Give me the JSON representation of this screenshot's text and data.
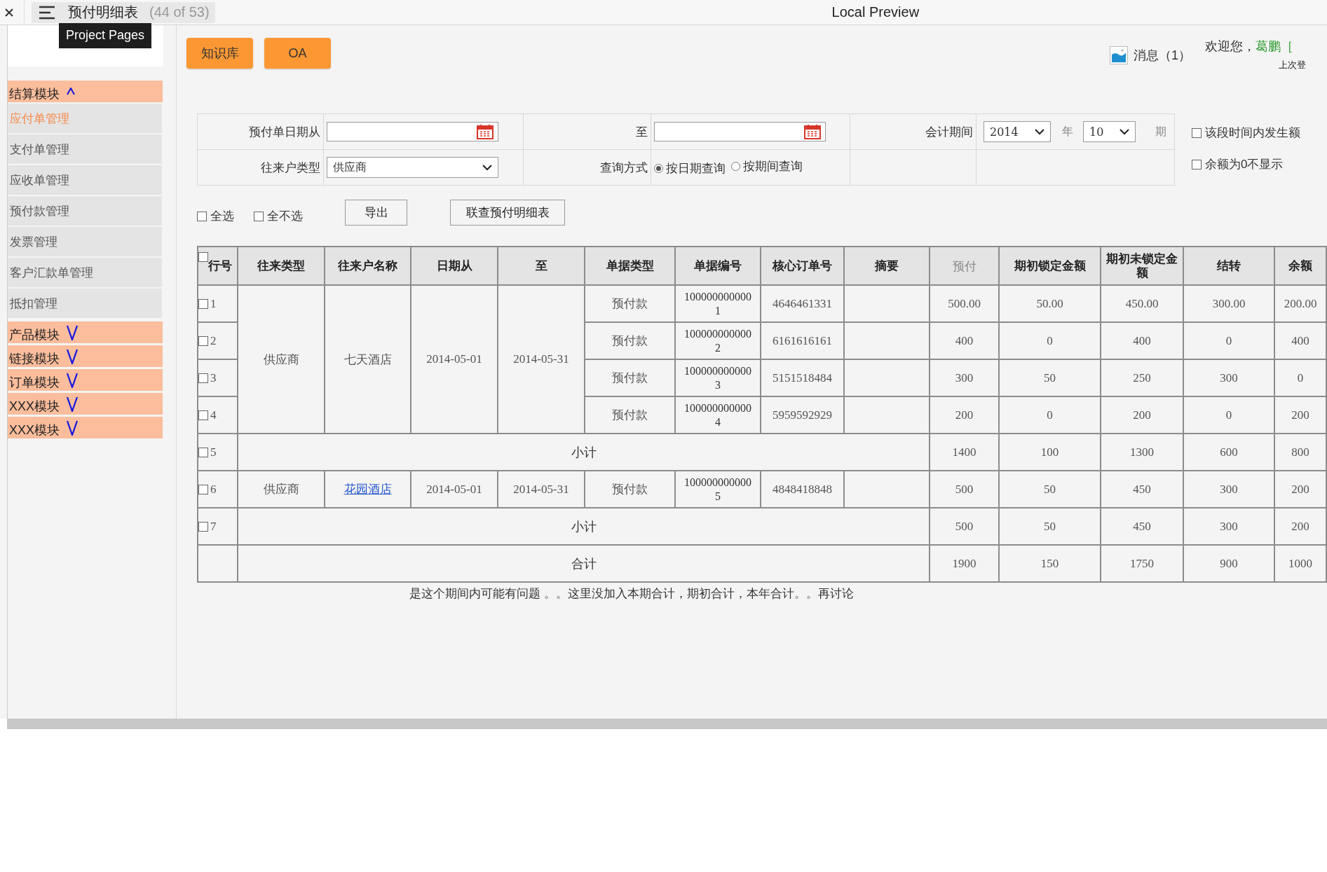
{
  "topbar": {
    "title": "预付明细表",
    "counter": "(44 of 53)",
    "app_title": "Local Preview"
  },
  "tooltip": "Project Pages",
  "sidebar": {
    "modules": [
      {
        "label": "结算模块",
        "expanded": true,
        "children": [
          {
            "label": "应付单管理",
            "selected": true
          },
          {
            "label": "支付单管理",
            "selected": false
          },
          {
            "label": "应收单管理",
            "selected": false
          },
          {
            "label": "预付款管理",
            "selected": false
          },
          {
            "label": "发票管理",
            "selected": false
          },
          {
            "label": "客户汇款单管理",
            "selected": false
          },
          {
            "label": "抵扣管理",
            "selected": false
          }
        ]
      },
      {
        "label": "产品模块",
        "expanded": false
      },
      {
        "label": "链接模块",
        "expanded": false
      },
      {
        "label": "订单模块",
        "expanded": false
      },
      {
        "label": "XXX模块",
        "expanded": false
      },
      {
        "label": "XXX模块",
        "expanded": false
      }
    ]
  },
  "header": {
    "buttons": [
      "知识库",
      "OA"
    ],
    "messages": "消息（1）",
    "welcome": "欢迎您，",
    "user": "葛鹏",
    "user_suffix": "［",
    "last_login": "上次登"
  },
  "filters": {
    "date_from_label": "预付单日期从",
    "date_to_label": "至",
    "period_label": "会计期间",
    "year": "2014",
    "year_unit": "年",
    "month": "10",
    "month_unit": "期",
    "partner_type_label": "往来户类型",
    "partner_type": "供应商",
    "query_mode_label": "查询方式",
    "query_modes": [
      {
        "label": "按日期查询",
        "selected": true
      },
      {
        "label": "按期间查询",
        "selected": false
      }
    ],
    "options": [
      {
        "label": "该段时间内发生额",
        "checked": false
      },
      {
        "label": "余额为0不显示",
        "checked": false
      }
    ]
  },
  "actions": {
    "select_all": {
      "label": "全选",
      "checked": false
    },
    "deselect_all": {
      "label": "全不选",
      "checked": false
    },
    "buttons": [
      "导出",
      "联查预付明细表"
    ]
  },
  "table": {
    "header_checked": false,
    "columns": [
      {
        "label": "行号",
        "bold": true
      },
      {
        "label": "往来类型",
        "bold": true
      },
      {
        "label": "往来户名称",
        "bold": true
      },
      {
        "label": "日期从",
        "bold": true
      },
      {
        "label": "至",
        "bold": true
      },
      {
        "label": "单据类型",
        "bold": true
      },
      {
        "label": "单据编号",
        "bold": true
      },
      {
        "label": "核心订单号",
        "bold": true
      },
      {
        "label": "摘要",
        "bold": true
      },
      {
        "label": "预付",
        "bold": false
      },
      {
        "label": "期初锁定金额",
        "bold": true
      },
      {
        "label": "期初未锁定金额",
        "bold": true
      },
      {
        "label": "结转",
        "bold": true
      },
      {
        "label": "余额",
        "bold": true
      }
    ],
    "groups": [
      {
        "type": "供应商",
        "partner": "七天酒店",
        "partner_link": false,
        "date_from": "2014-05-01",
        "date_to": "2014-05-31",
        "rows": [
          {
            "row_no": "1",
            "checked": false,
            "doc_type": "预付款",
            "doc_no": "1000000000001",
            "order_no": "4646461331",
            "amounts": [
              "500.00",
              "50.00",
              "450.00",
              "300.00",
              "200.00"
            ]
          },
          {
            "row_no": "2",
            "checked": false,
            "doc_type": "预付款",
            "doc_no": "1000000000002",
            "order_no": "6161616161",
            "amounts": [
              "400",
              "0",
              "400",
              "0",
              "400"
            ]
          },
          {
            "row_no": "3",
            "checked": false,
            "doc_type": "预付款",
            "doc_no": "1000000000003",
            "order_no": "5151518484",
            "amounts": [
              "300",
              "50",
              "250",
              "300",
              "0"
            ]
          },
          {
            "row_no": "4",
            "checked": false,
            "doc_type": "预付款",
            "doc_no": "1000000000004",
            "order_no": "5959592929",
            "amounts": [
              "200",
              "0",
              "200",
              "0",
              "200"
            ]
          }
        ],
        "subtotal": {
          "row_no": "5",
          "checked": false,
          "label": "小计",
          "amounts": [
            "1400",
            "100",
            "1300",
            "600",
            "800"
          ]
        }
      },
      {
        "type": "供应商",
        "partner": "花园酒店",
        "partner_link": true,
        "date_from": "2014-05-01",
        "date_to": "2014-05-31",
        "rows": [
          {
            "row_no": "6",
            "checked": false,
            "doc_type": "预付款",
            "doc_no": "1000000000005",
            "order_no": "4848418848",
            "amounts": [
              "500",
              "50",
              "450",
              "300",
              "200"
            ]
          }
        ],
        "subtotal": {
          "row_no": "7",
          "checked": false,
          "label": "小计",
          "amounts": [
            "500",
            "50",
            "450",
            "300",
            "200"
          ]
        }
      }
    ],
    "total": {
      "label": "合计",
      "amounts": [
        "1900",
        "150",
        "1750",
        "900",
        "1000"
      ]
    }
  },
  "note": "是这个期间内可能有问题 。。这里没加入本期合计，期初合计，本年合计。。再讨论"
}
